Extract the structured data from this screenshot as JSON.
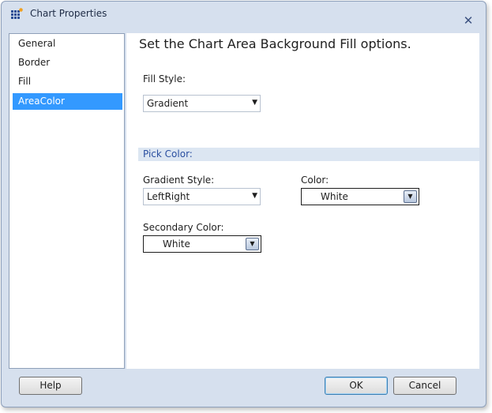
{
  "window": {
    "title": "Chart Properties",
    "icon": "chart-grid-icon",
    "close_icon": "close-icon"
  },
  "nav": {
    "items": [
      {
        "label": "General",
        "selected": false
      },
      {
        "label": "Border",
        "selected": false
      },
      {
        "label": "Fill",
        "selected": false
      },
      {
        "label": "AreaColor",
        "selected": true
      }
    ]
  },
  "content": {
    "heading": "Set the Chart Area Background Fill options.",
    "fill_style": {
      "label": "Fill Style:",
      "value": "Gradient"
    },
    "pick_color": {
      "label": "Pick Color:"
    },
    "gradient_style": {
      "label": "Gradient Style:",
      "value": "LeftRight"
    },
    "color": {
      "label": "Color:",
      "value": "White"
    },
    "secondary_color": {
      "label": "Secondary Color:",
      "value": "White"
    }
  },
  "buttons": {
    "help": "Help",
    "ok": "OK",
    "cancel": "Cancel"
  },
  "colors": {
    "selection": "#3399ff",
    "section_bar": "#dce6f2",
    "frame": "#d6e0ee"
  }
}
